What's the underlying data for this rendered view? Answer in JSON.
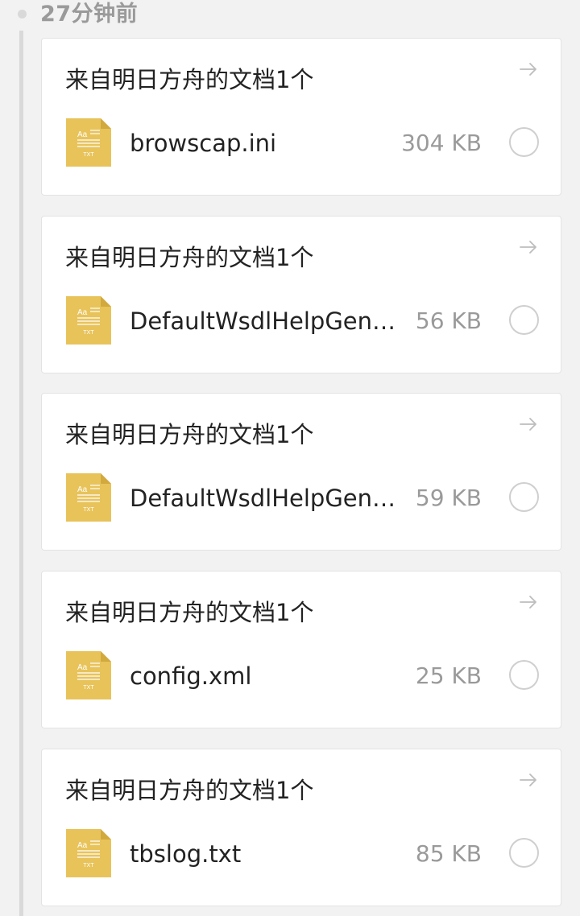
{
  "timeline": {
    "time_label": "27分钟前"
  },
  "cards": [
    {
      "title": "来自明日方舟的文档1个",
      "file_name": "browscap.ini",
      "file_size": "304 KB",
      "icon_text": "Aa",
      "icon_ext": "TXT"
    },
    {
      "title": "来自明日方舟的文档1个",
      "file_name": "DefaultWsdlHelpGenera...",
      "file_size": "56 KB",
      "icon_text": "Aa",
      "icon_ext": "TXT"
    },
    {
      "title": "来自明日方舟的文档1个",
      "file_name": "DefaultWsdlHelpGenera...",
      "file_size": "59 KB",
      "icon_text": "Aa",
      "icon_ext": "TXT"
    },
    {
      "title": "来自明日方舟的文档1个",
      "file_name": "config.xml",
      "file_size": "25 KB",
      "icon_text": "Aa",
      "icon_ext": "TXT"
    },
    {
      "title": "来自明日方舟的文档1个",
      "file_name": "tbslog.txt",
      "file_size": "85 KB",
      "icon_text": "Aa",
      "icon_ext": "TXT"
    }
  ],
  "colors": {
    "icon_fill": "#e8c35a",
    "icon_fold": "#d1a93d",
    "icon_text": "#ffffff",
    "arrow": "#bdbdbd"
  },
  "icons": {
    "file": "txt-file-icon",
    "arrow": "arrow-right-icon",
    "select": "radio-circle-icon"
  }
}
